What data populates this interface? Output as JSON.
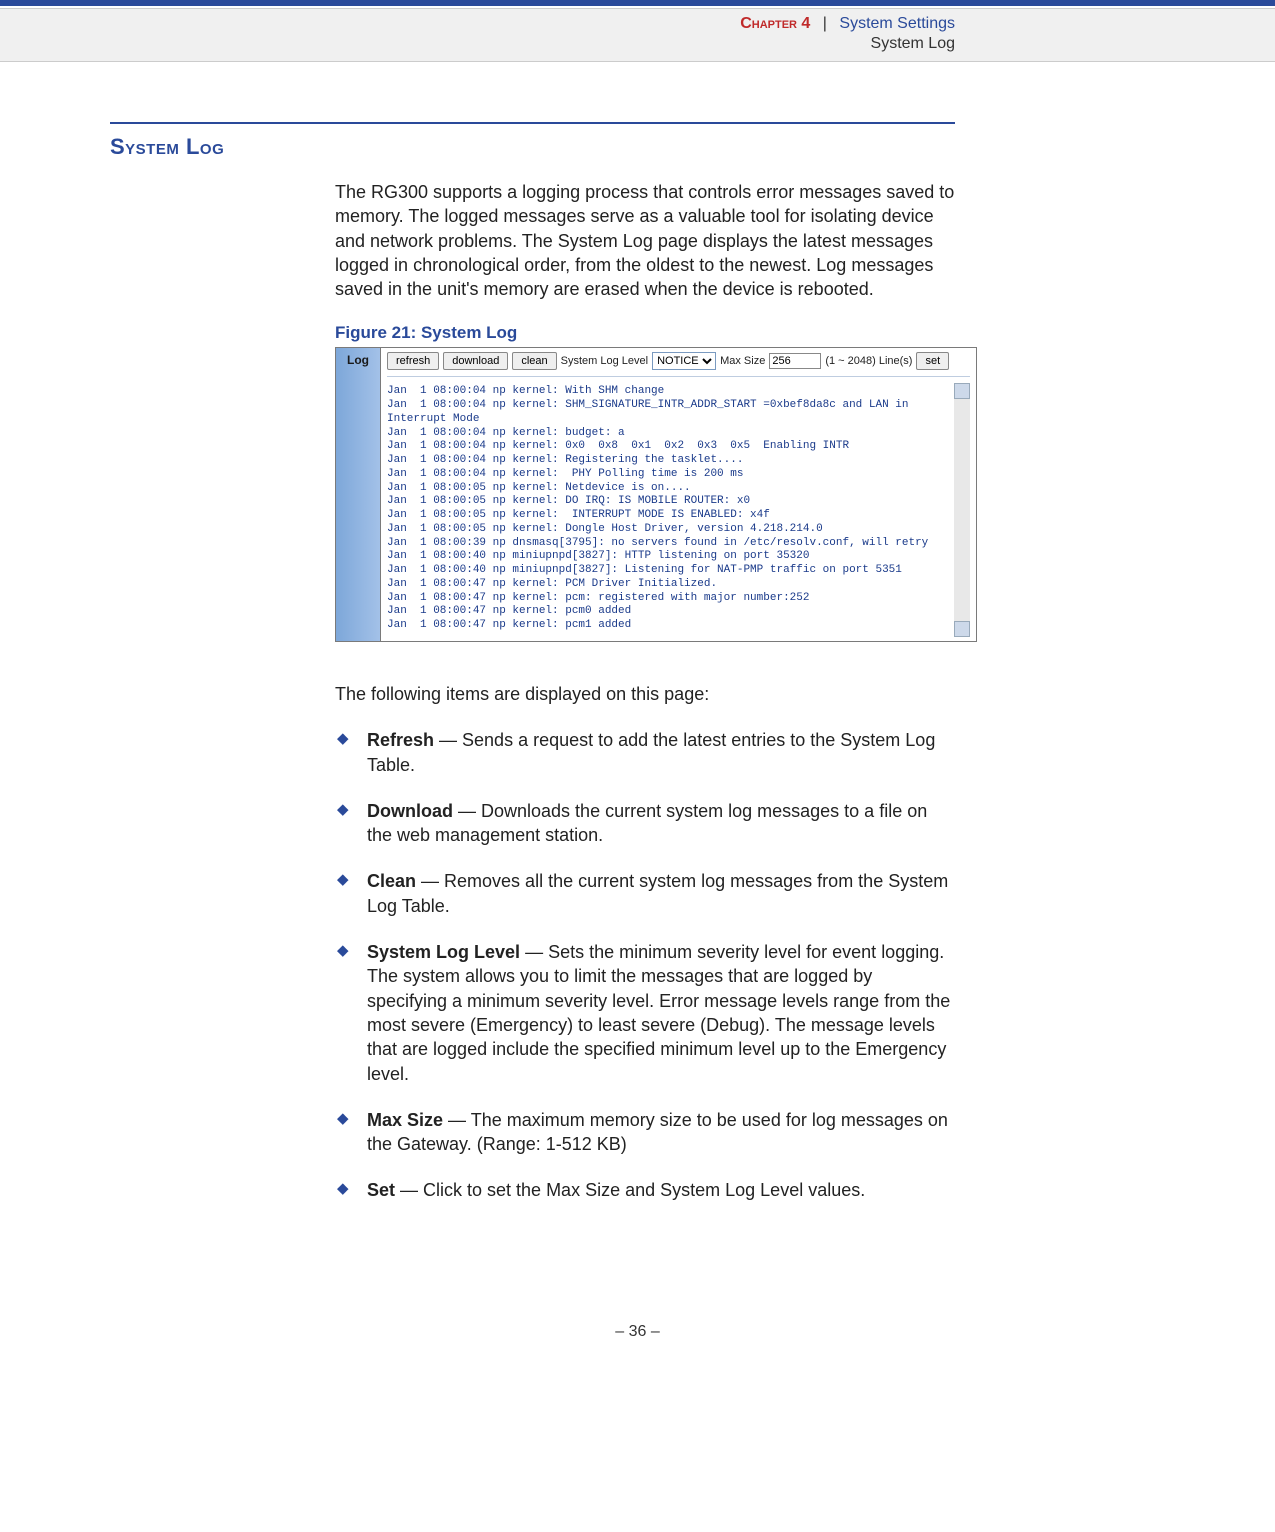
{
  "header": {
    "chapter_label": "Chapter 4",
    "separator": "|",
    "chapter_title": "System Settings",
    "subtitle": "System Log"
  },
  "section": {
    "title": "System Log",
    "intro": "The RG300 supports a logging process that controls error messages saved to memory. The logged messages serve as a valuable tool for isolating device and network problems. The System Log page displays the latest messages logged in chronological order, from the oldest to the newest. Log messages saved in the unit's memory are erased when the device is rebooted."
  },
  "figure": {
    "caption": "Figure 21:  System Log",
    "side_tab": "Log",
    "controls": {
      "refresh": "refresh",
      "download": "download",
      "clean": "clean",
      "level_label": "System Log Level",
      "level_value": "NOTICE",
      "maxsize_label": "Max Size",
      "maxsize_value": "256",
      "range_label": "(1 ~ 2048) Line(s)",
      "set": "set"
    },
    "log_lines": [
      "Jan  1 08:00:04 np kernel: With SHM change",
      "Jan  1 08:00:04 np kernel: SHM_SIGNATURE_INTR_ADDR_START =0xbef8da8c and LAN in",
      "Interrupt Mode",
      "Jan  1 08:00:04 np kernel: budget: a",
      "Jan  1 08:00:04 np kernel: 0x0  0x8  0x1  0x2  0x3  0x5  Enabling INTR",
      "Jan  1 08:00:04 np kernel: Registering the tasklet....",
      "Jan  1 08:00:04 np kernel:  PHY Polling time is 200 ms",
      "Jan  1 08:00:05 np kernel: Netdevice is on....",
      "Jan  1 08:00:05 np kernel: DO IRQ: IS MOBILE ROUTER: x0",
      "Jan  1 08:00:05 np kernel:  INTERRUPT MODE IS ENABLED: x4f",
      "Jan  1 08:00:05 np kernel: Dongle Host Driver, version 4.218.214.0",
      "Jan  1 08:00:39 np dnsmasq[3795]: no servers found in /etc/resolv.conf, will retry",
      "Jan  1 08:00:40 np miniupnpd[3827]: HTTP listening on port 35320",
      "Jan  1 08:00:40 np miniupnpd[3827]: Listening for NAT-PMP traffic on port 5351",
      "Jan  1 08:00:47 np kernel: PCM Driver Initialized.",
      "Jan  1 08:00:47 np kernel: pcm: registered with major number:252",
      "Jan  1 08:00:47 np kernel: pcm0 added",
      "Jan  1 08:00:47 np kernel: pcm1 added"
    ]
  },
  "follow_text": "The following items are displayed on this page:",
  "items": [
    {
      "term": "Refresh",
      "desc": " — Sends a request to add the latest entries to the System Log Table."
    },
    {
      "term": "Download",
      "desc": " — Downloads the current system log messages to a file on the web management station."
    },
    {
      "term": "Clean",
      "desc": " — Removes all the current system log messages from the System Log Table."
    },
    {
      "term": "System Log Level",
      "desc": " — Sets the minimum severity level for event logging. The system allows you to limit the messages that are logged by specifying a minimum severity level. Error message levels range from the most severe (Emergency) to least severe (Debug). The message levels that are logged include the specified minimum level up to the Emergency level."
    },
    {
      "term": "Max Size",
      "desc": " — The maximum memory size to be used for log messages on the Gateway. (Range: 1-512 KB)"
    },
    {
      "term": "Set",
      "desc": " — Click to set the Max Size and System Log Level values."
    }
  ],
  "footer": "–  36  –"
}
